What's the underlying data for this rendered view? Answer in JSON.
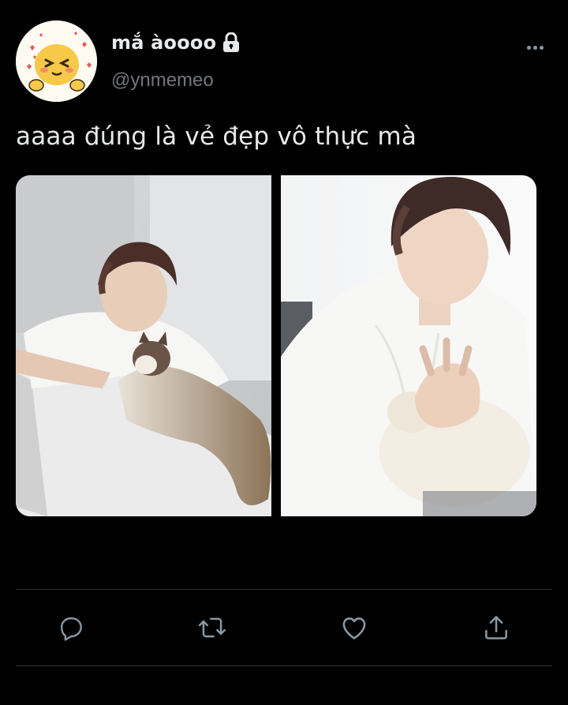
{
  "tweet": {
    "author_name": "mắ àoooo",
    "author_handle": "@ynmemeo",
    "protected": true,
    "text": "aaaa đúng là vẻ đẹp vô thực mà",
    "media_count": 2
  },
  "icons": {
    "more": "more-horizontal-icon",
    "lock": "lock-icon",
    "reply": "reply-icon",
    "retweet": "retweet-icon",
    "like": "heart-icon",
    "share": "share-icon"
  },
  "colors": {
    "background": "#000000",
    "text_primary": "#e7e9ea",
    "text_secondary": "#71767b",
    "divider": "#2f3336",
    "icon": "#8b98a5"
  }
}
